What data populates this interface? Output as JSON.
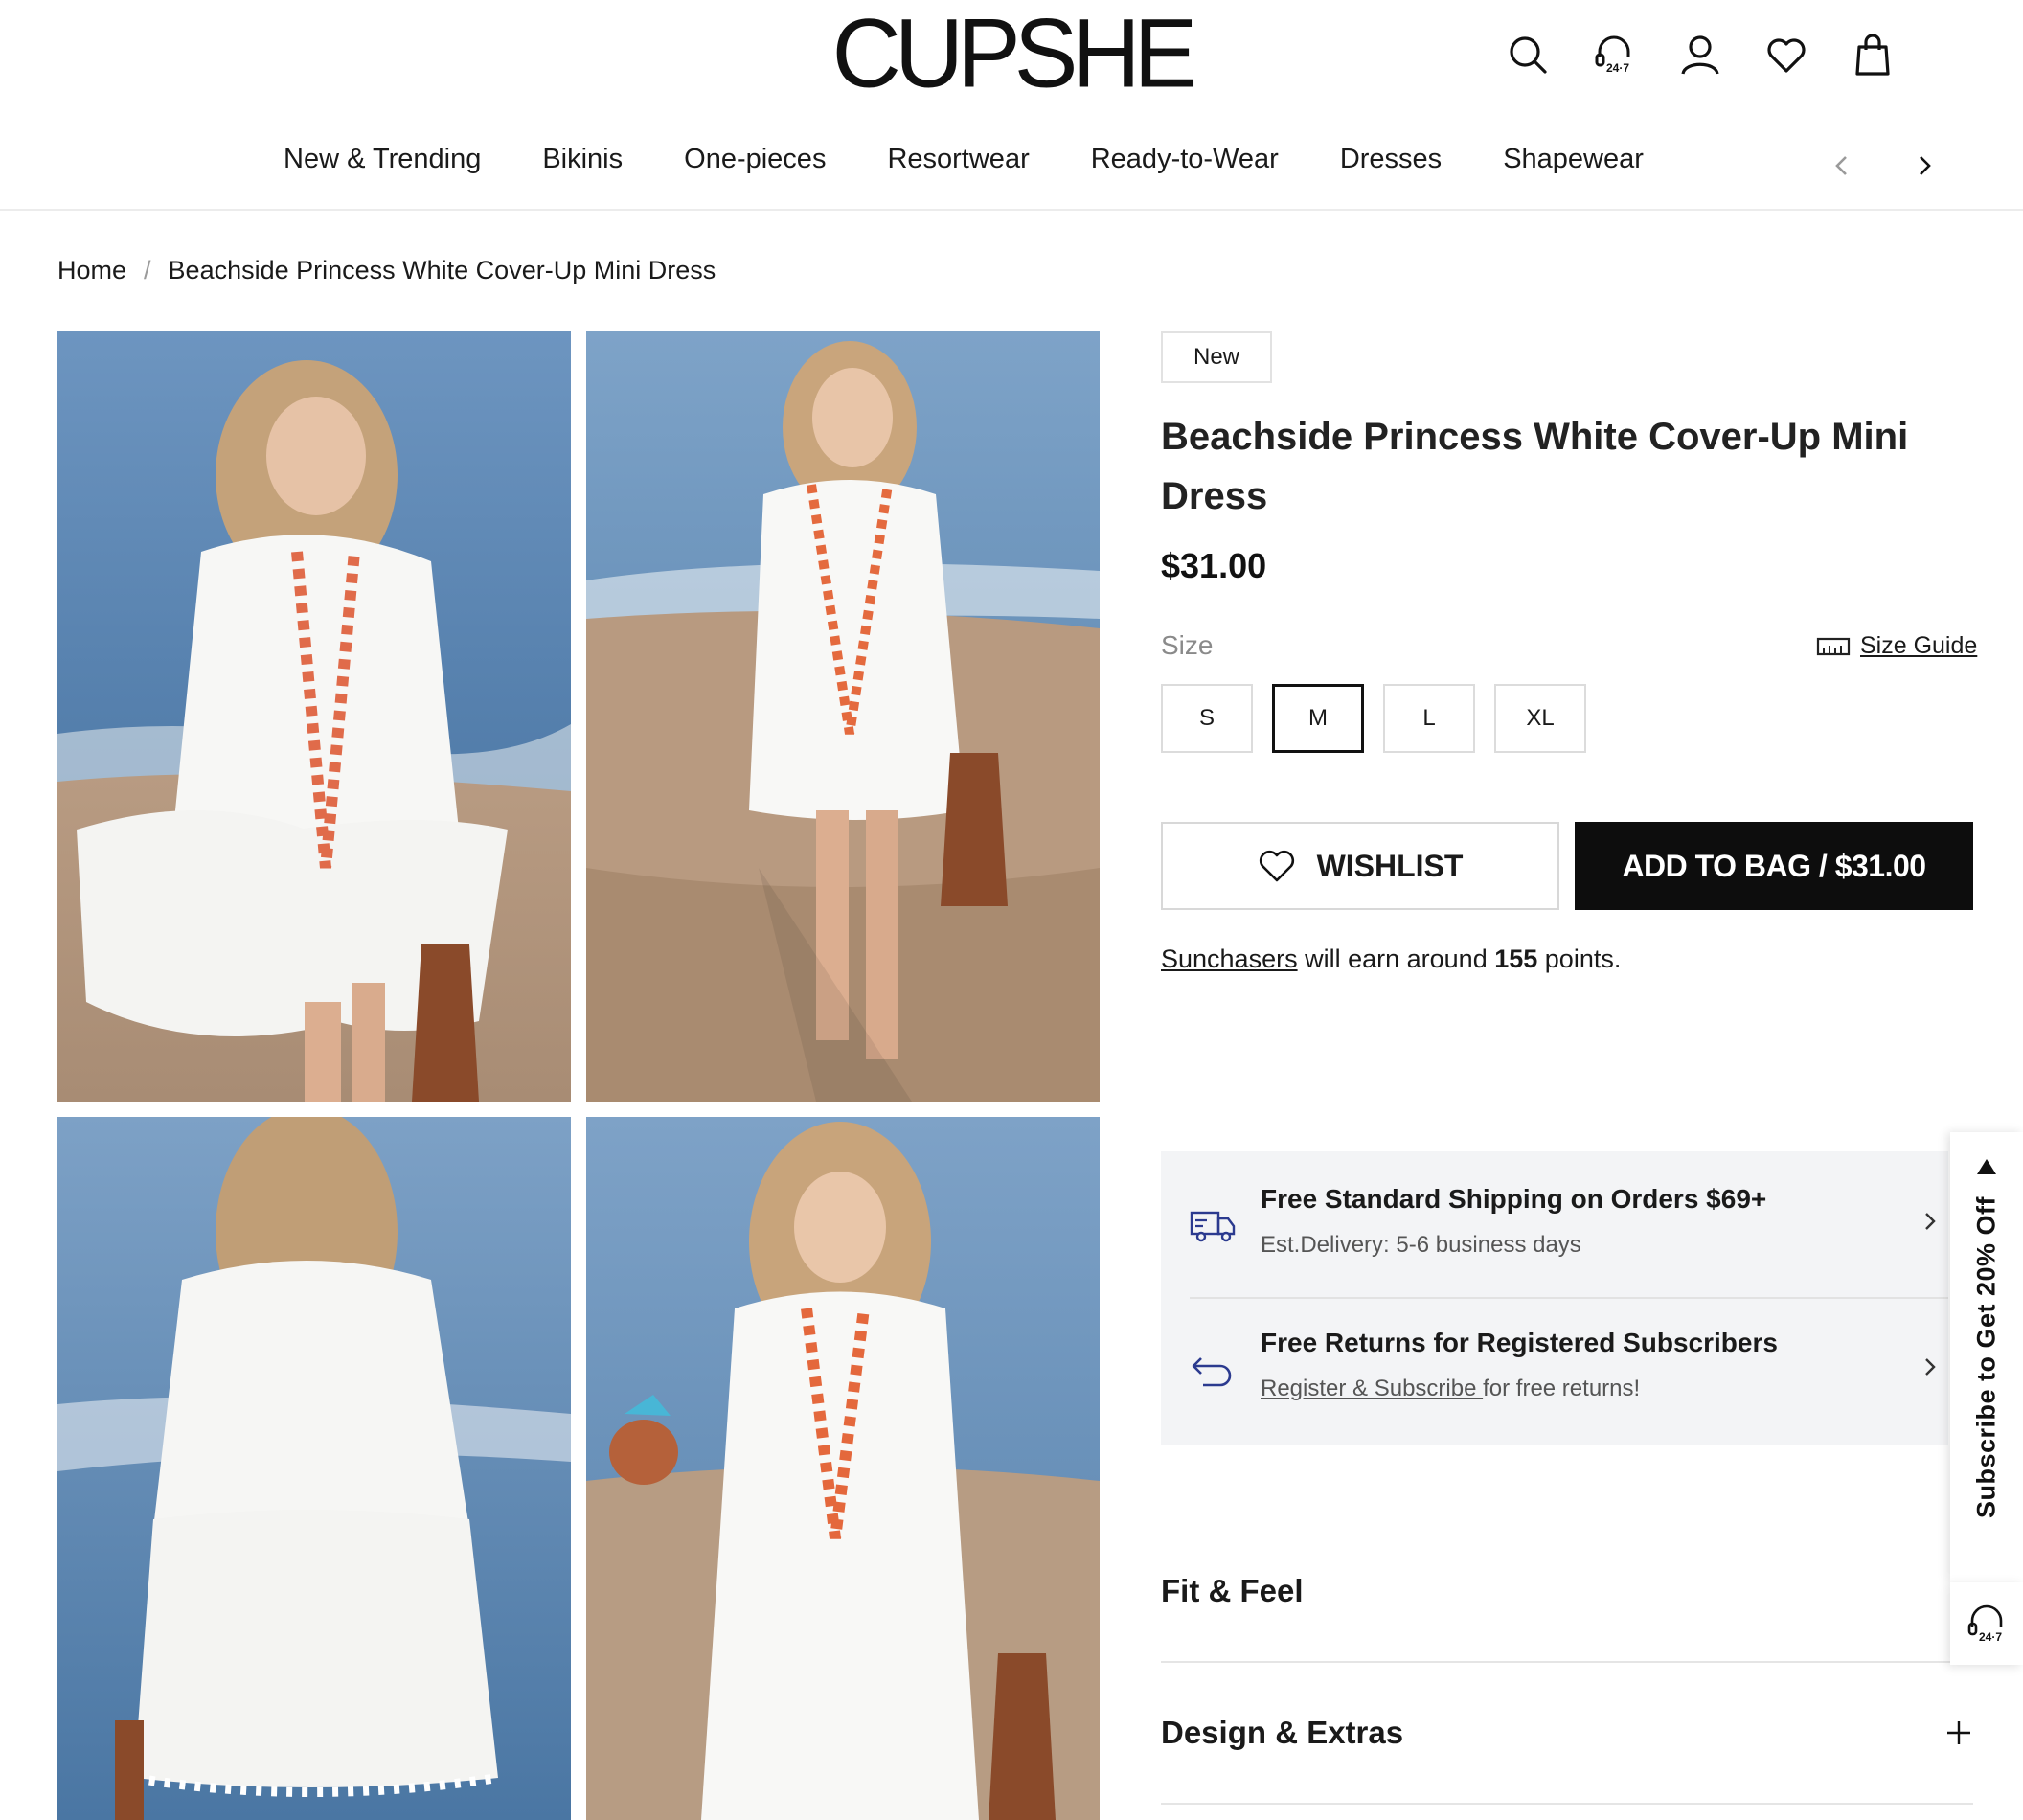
{
  "brand": "CUPSHE",
  "header_icons": [
    "search-icon",
    "support-247-icon",
    "account-icon",
    "wishlist-heart-icon",
    "shopping-bag-icon"
  ],
  "support_badge": "24·7",
  "nav": {
    "items": [
      "New & Trending",
      "Bikinis",
      "One-pieces",
      "Resortwear",
      "Ready-to-Wear",
      "Dresses",
      "Shapewear"
    ]
  },
  "breadcrumb": {
    "home": "Home",
    "separator": "/",
    "current": "Beachside Princess White Cover-Up Mini Dress"
  },
  "product": {
    "badge": "New",
    "title": "Beachside Princess White Cover-Up Mini Dress",
    "price": "$31.00",
    "size_label": "Size",
    "size_guide": "Size Guide",
    "sizes": [
      "S",
      "M",
      "L",
      "XL"
    ],
    "selected_size": "M",
    "wishlist_label": "WISHLIST",
    "add_to_bag_label": "ADD TO BAG / $31.00",
    "points": {
      "link": "Sunchasers",
      "pre": " will earn around ",
      "value": "155",
      "post": " points."
    }
  },
  "shipping": {
    "title": "Free Standard Shipping on Orders $69+",
    "subtitle": "Est.Delivery: 5-6 business days"
  },
  "returns": {
    "title": "Free Returns for Registered Subscribers",
    "link": "Register & Subscribe ",
    "rest": "for free returns!"
  },
  "accordions": [
    "Fit & Feel",
    "Design & Extras"
  ],
  "subscribe_tab": "Subscribe to Get 20% Off",
  "colors": {
    "accent": "#0d0d0d",
    "panel_bg": "#f3f4f6",
    "icon_blue": "#2b3a8f"
  }
}
